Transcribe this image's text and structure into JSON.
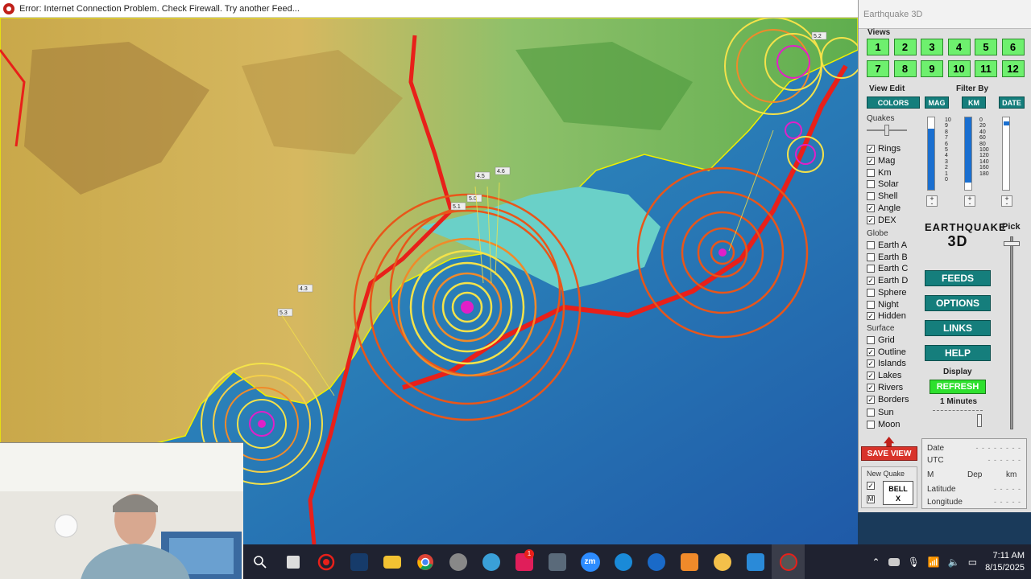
{
  "error_bar": {
    "message": "Error: Internet Connection Problem. Check Firewall. Try another Feed..."
  },
  "panel": {
    "title": "Earthquake 3D",
    "views_label": "Views",
    "views": [
      "1",
      "2",
      "3",
      "4",
      "5",
      "6",
      "7",
      "8",
      "9",
      "10",
      "11",
      "12"
    ],
    "view_edit_label": "View Edit",
    "filter_by_label": "Filter By",
    "colors_button": "COLORS",
    "mag_button": "MAG",
    "km_button": "KM",
    "date_button": "DATE",
    "quakes_label": "Quakes",
    "options": [
      {
        "label": "Rings",
        "checked": true
      },
      {
        "label": "Mag",
        "checked": true
      },
      {
        "label": "Km",
        "checked": false
      },
      {
        "label": "Solar",
        "checked": false
      },
      {
        "label": "Shell",
        "checked": false
      },
      {
        "label": "Angle",
        "checked": true
      },
      {
        "label": "DEX",
        "checked": true
      }
    ],
    "globe_label": "Globe",
    "globe_options": [
      {
        "label": "Earth A",
        "checked": false
      },
      {
        "label": "Earth B",
        "checked": false
      },
      {
        "label": "Earth C",
        "checked": false
      },
      {
        "label": "Earth D",
        "checked": true
      },
      {
        "label": "Sphere",
        "checked": false
      },
      {
        "label": "Night",
        "checked": false
      },
      {
        "label": "Hidden",
        "checked": true
      }
    ],
    "surface_label": "Surface",
    "surface_options": [
      {
        "label": "Grid",
        "checked": false
      },
      {
        "label": "Outline",
        "checked": true
      },
      {
        "label": "Islands",
        "checked": true
      },
      {
        "label": "Lakes",
        "checked": true
      },
      {
        "label": "Rivers",
        "checked": true
      },
      {
        "label": "Borders",
        "checked": true
      },
      {
        "label": "Sun",
        "checked": false
      },
      {
        "label": "Moon",
        "checked": false
      }
    ],
    "mag_scale": [
      "10",
      "9",
      "8",
      "7",
      "6",
      "5",
      "4",
      "3",
      "2",
      "1",
      "0"
    ],
    "km_scale": [
      "0",
      "20",
      "40",
      "60",
      "80",
      "100",
      "120",
      "140",
      "160",
      "180"
    ],
    "mag_fill": 0.85,
    "km_fill": 0.9,
    "logo_line1": "EARTHQUAKE",
    "logo_line2": "3D",
    "pick_label": "Pick",
    "feeds_button": "FEEDS",
    "options_button": "OPTIONS",
    "links_button": "LINKS",
    "help_button": "HELP",
    "display_label": "Display",
    "refresh_button": "REFRESH",
    "refresh_interval": "1 Minutes",
    "save_view_button": "SAVE VIEW",
    "new_quake_label": "New Quake",
    "bell_button": "BELL",
    "bell_x": "X",
    "m_label": "M",
    "info": {
      "date": "Date",
      "utc": "UTC",
      "m": "M",
      "dep": "Dep",
      "km": "km",
      "latitude": "Latitude",
      "longitude": "Longitude"
    }
  },
  "map_labels": [
    "4.3",
    "5.3",
    "4.5",
    "4.6",
    "5.0",
    "5.1",
    "5.2"
  ],
  "taskbar": {
    "time": "7:11 AM",
    "date": "8/15/2025",
    "zoom_label": "zm",
    "notification_count": "1"
  },
  "colors": {
    "plate_boundary": "#e8201a",
    "ring_orange": "#e8561a",
    "ring_yellow": "#f4e24a",
    "epicenter": "#e020c8",
    "button_teal": "#157e7c",
    "button_green": "#6ef06e"
  }
}
